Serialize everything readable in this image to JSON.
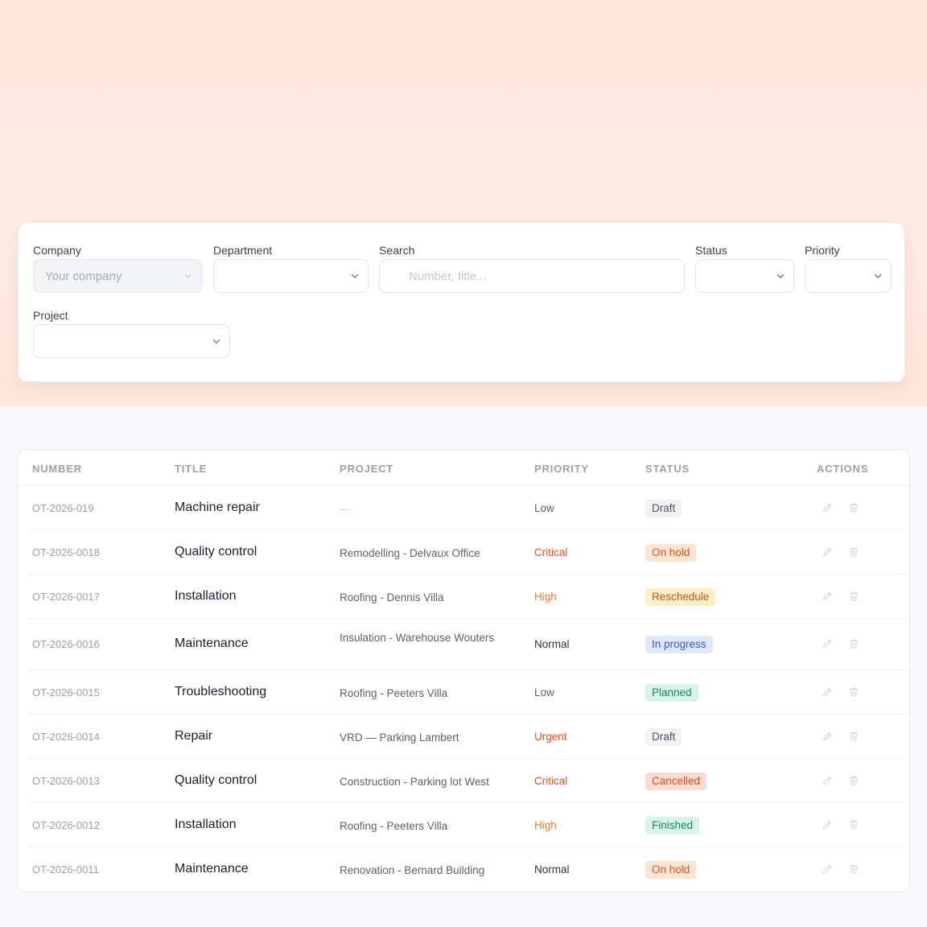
{
  "filters": {
    "company": {
      "label": "Company",
      "value": "Your company"
    },
    "department": {
      "label": "Department",
      "value": ""
    },
    "search": {
      "label": "Search",
      "placeholder": "Number, title..."
    },
    "status": {
      "label": "Status",
      "value": ""
    },
    "priority": {
      "label": "Priority",
      "value": ""
    },
    "project": {
      "label": "Project",
      "value": ""
    }
  },
  "table": {
    "headers": {
      "number": "NUMBER",
      "title": "TITLE",
      "project": "PROJECT",
      "priority": "PRIORITY",
      "status": "STATUS",
      "actions": "ACTIONS"
    },
    "rows": [
      {
        "number": "OT-2026-019",
        "title": "Machine repair",
        "project": "—",
        "priority": "Low",
        "status": "Draft"
      },
      {
        "number": "OT-2026-0018",
        "title": "Quality control",
        "project": "Remodelling - Delvaux Office",
        "priority": "Critical",
        "status": "On hold"
      },
      {
        "number": "OT-2026-0017",
        "title": "Installation",
        "project": "Roofing - Dennis Villa",
        "priority": "High",
        "status": "Reschedule"
      },
      {
        "number": "OT-2026-0016",
        "title": "Maintenance",
        "project": "Insulation - Warehouse Wouters",
        "priority": "Normal",
        "status": "In progress"
      },
      {
        "number": "OT-2026-0015",
        "title": "Troubleshooting",
        "project": "Roofing - Peeters Villa",
        "priority": "Low",
        "status": "Planned"
      },
      {
        "number": "OT-2026-0014",
        "title": "Repair",
        "project": "VRD — Parking Lambert",
        "priority": "Urgent",
        "status": "Draft"
      },
      {
        "number": "OT-2026-0013",
        "title": "Quality control",
        "project": "Construction - Parking lot West",
        "priority": "Critical",
        "status": "Cancelled"
      },
      {
        "number": "OT-2026-0012",
        "title": "Installation",
        "project": "Roofing - Peeters Villa",
        "priority": "High",
        "status": "Finished"
      },
      {
        "number": "OT-2026-0011",
        "title": "Maintenance",
        "project": "Renovation - Bernard Building",
        "priority": "Normal",
        "status": "On hold"
      }
    ]
  },
  "priority_colors": {
    "Low": "#5b616d",
    "Normal": "#2f3440",
    "High": "#f07a2a",
    "Critical": "#ee4a1c",
    "Urgent": "#ee4a1c"
  },
  "status_styles": {
    "Draft": {
      "bg": "#f1f2f5",
      "fg": "#4f5563"
    },
    "On hold": {
      "bg": "#fde4d3",
      "fg": "#e8531c"
    },
    "Reschedule": {
      "bg": "#fdefc7",
      "fg": "#d4521a"
    },
    "In progress": {
      "bg": "#e1e8f8",
      "fg": "#2b5fd9"
    },
    "Planned": {
      "bg": "#d8f4e8",
      "fg": "#0f8a5a"
    },
    "Cancelled": {
      "bg": "#fcdcd1",
      "fg": "#e2481e"
    },
    "Finished": {
      "bg": "#d8f4e8",
      "fg": "#0f8a5a"
    }
  },
  "row_icons": [
    "pencil-icon",
    "trash-icon"
  ]
}
